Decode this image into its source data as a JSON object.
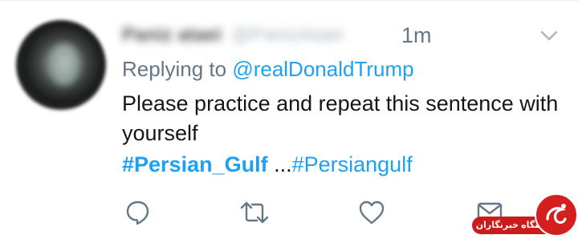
{
  "tweet": {
    "display_name": "Paniz ataei",
    "handle": "@PanizAtaei",
    "timestamp": "1m",
    "reply_prefix": "Replying to",
    "reply_to": "@realDonaldTrump",
    "text": "Please practice and repeat this sentence with yourself",
    "hashtag_primary": "#Persian_Gulf",
    "ellipsis": " ...",
    "hashtag_secondary": "#Persiangulf"
  },
  "actions": [
    {
      "name": "reply",
      "icon": "reply-bubble-icon"
    },
    {
      "name": "retweet",
      "icon": "retweet-icon"
    },
    {
      "name": "like",
      "icon": "heart-icon"
    },
    {
      "name": "message",
      "icon": "envelope-icon"
    }
  ],
  "watermark": {
    "text": "باشگاه خبرنگاران"
  },
  "colors": {
    "link": "#1da1f2",
    "muted": "#657786",
    "text": "#14171a",
    "watermark": "#cc1b1b"
  }
}
